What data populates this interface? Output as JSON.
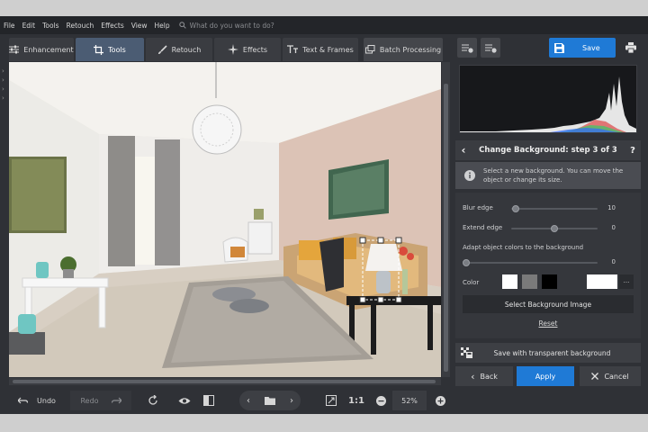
{
  "menu": {
    "items": [
      "File",
      "Edit",
      "Tools",
      "Retouch",
      "Effects",
      "View",
      "Help"
    ],
    "search_placeholder": "What do you want to do?"
  },
  "tabs": [
    {
      "label": "Enhancement",
      "icon": "sliders-icon"
    },
    {
      "label": "Tools",
      "icon": "crop-icon"
    },
    {
      "label": "Retouch",
      "icon": "brush-icon"
    },
    {
      "label": "Effects",
      "icon": "sparkle-icon"
    },
    {
      "label": "Text & Frames",
      "icon": "text-icon"
    },
    {
      "label": "Batch Processing",
      "icon": "batch-icon"
    }
  ],
  "toolbar": {
    "undo_label": "Undo",
    "redo_label": "Redo",
    "one_to_one": "1:1",
    "zoom_level": "52%"
  },
  "right": {
    "save_label": "Save",
    "step_title": "Change Background: step 3 of 3",
    "help_glyph": "?",
    "info_text": "Select a new background. You can move the object or change its size.",
    "blur_label": "Blur edge",
    "blur_value": "10",
    "blur_level": 0.05,
    "extend_label": "Extend edge",
    "extend_value": "0",
    "extend_level": 0.5,
    "adapt_label": "Adapt object colors to the background",
    "adapt_value": "0",
    "adapt_level": 0.0,
    "color_label": "Color",
    "more_glyph": "...",
    "select_bg_label": "Select Background Image",
    "reset_label": "Reset",
    "transparent_label": "Save with transparent background",
    "back_label": "Back",
    "apply_label": "Apply",
    "cancel_label": "Cancel"
  },
  "colors": {
    "accent": "#1f7ad6",
    "active_tab": "#4b5c73",
    "swatch_white": "#ffffff",
    "swatch_gray": "#7a7a7a",
    "swatch_black": "#000000"
  }
}
